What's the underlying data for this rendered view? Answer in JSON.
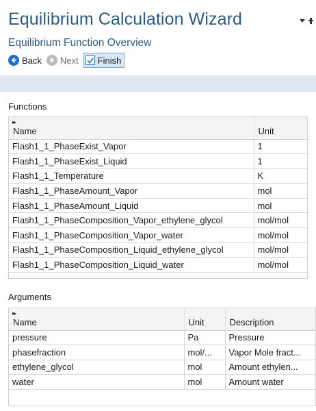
{
  "header": {
    "title": "Equilibrium Calculation Wizard",
    "subtitle": "Equilibrium Function Overview"
  },
  "toolbar": {
    "back_label": "Back",
    "next_label": "Next",
    "finish_label": "Finish"
  },
  "functions": {
    "label": "Functions",
    "columns": [
      "Name",
      "Unit"
    ],
    "rows": [
      [
        "Flash1_1_PhaseExist_Vapor",
        "1"
      ],
      [
        "Flash1_1_PhaseExist_Liquid",
        "1"
      ],
      [
        "Flash1_1_Temperature",
        "K"
      ],
      [
        "Flash1_1_PhaseAmount_Vapor",
        "mol"
      ],
      [
        "Flash1_1_PhaseAmount_Liquid",
        "mol"
      ],
      [
        "Flash1_1_PhaseComposition_Vapor_ethylene_glycol",
        "mol/mol"
      ],
      [
        "Flash1_1_PhaseComposition_Vapor_water",
        "mol/mol"
      ],
      [
        "Flash1_1_PhaseComposition_Liquid_ethylene_glycol",
        "mol/mol"
      ],
      [
        "Flash1_1_PhaseComposition_Liquid_water",
        "mol/mol"
      ]
    ]
  },
  "arguments": {
    "label": "Arguments",
    "columns": [
      "Name",
      "Unit",
      "Description"
    ],
    "rows": [
      [
        "pressure",
        "Pa",
        "Pressure"
      ],
      [
        "phasefraction",
        "mol/...",
        "Vapor Mole fract..."
      ],
      [
        "ethylene_glycol",
        "mol",
        "Amount ethylen..."
      ],
      [
        "water",
        "mol",
        "Amount water"
      ]
    ]
  },
  "colors": {
    "title": "#2a5c86",
    "back_icon": "#1f6fc5",
    "band": "#dfe7f1"
  }
}
